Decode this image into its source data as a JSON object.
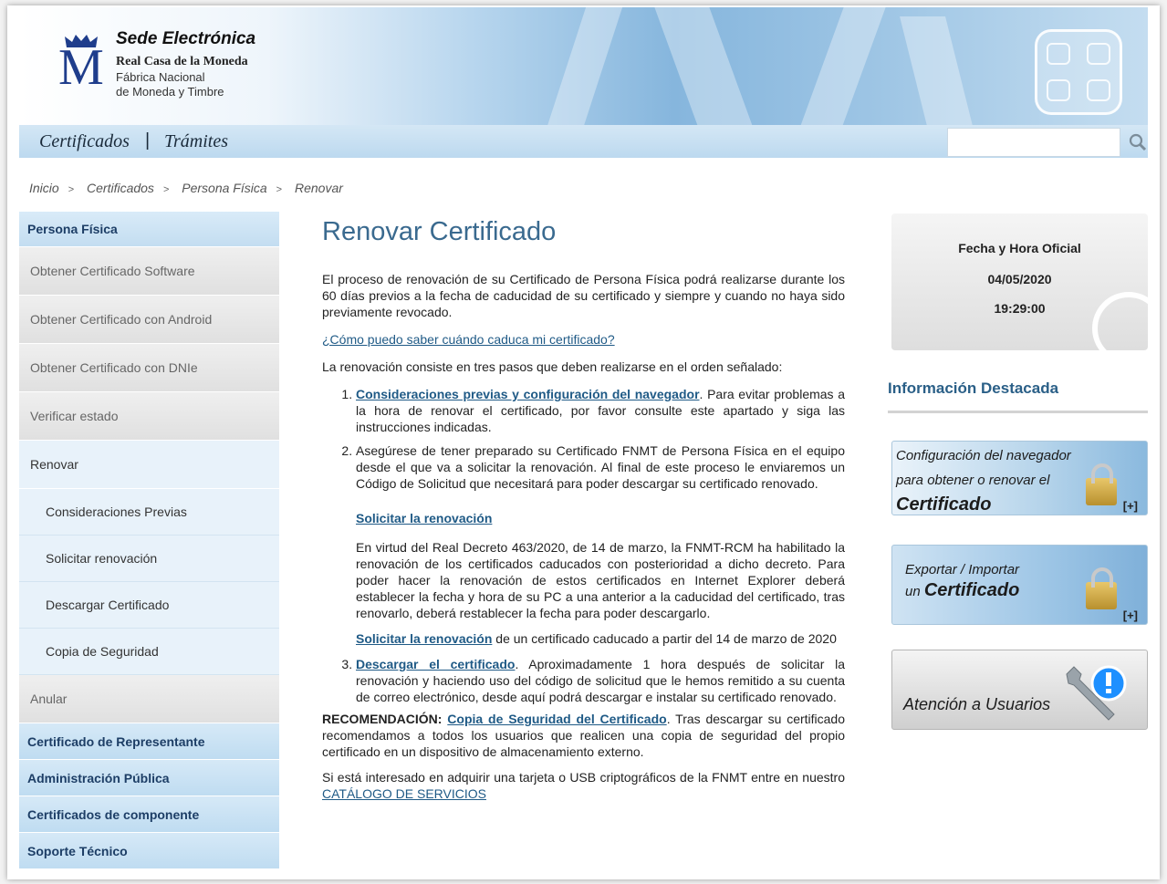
{
  "header": {
    "brand_title": "Sede Electrónica",
    "brand_line1": "Real Casa de la Moneda",
    "brand_line2": "Fábrica Nacional",
    "brand_line3": "de Moneda y Timbre",
    "logo_letter": "M"
  },
  "nav": {
    "items": [
      "Certificados",
      "Trámites"
    ],
    "separator": "|",
    "search_placeholder": ""
  },
  "breadcrumb": {
    "items": [
      "Inicio",
      "Certificados",
      "Persona Física",
      "Renovar"
    ],
    "separator": ">"
  },
  "sidebar": {
    "header": "Persona Física",
    "items": [
      "Obtener Certificado Software",
      "Obtener Certificado con Android",
      "Obtener Certificado con DNIe",
      "Verificar estado",
      "Renovar"
    ],
    "sub_items": [
      "Consideraciones Previas",
      "Solicitar renovación",
      "Descargar Certificado",
      "Copia de Seguridad"
    ],
    "after": "Anular",
    "sections": [
      "Certificado de Representante",
      "Administración Pública",
      "Certificados de componente",
      "Soporte Técnico"
    ]
  },
  "main": {
    "title": "Renovar Certificado",
    "intro": "El proceso de renovación de su Certificado de Persona Física podrá realizarse durante los 60 días previos a la fecha de caducidad de su certificado y siempre y cuando no haya sido previamente revocado.",
    "faq_link": "¿Cómo puedo saber cuándo caduca mi certificado?",
    "steps_intro": "La renovación consiste en tres pasos que deben realizarse en el orden señalado:",
    "step1_link": "Consideraciones previas y configuración del navegador",
    "step1_text": ". Para evitar problemas a la hora de renovar el certificado, por favor consulte este apartado y siga las instrucciones indicadas.",
    "step2_text": "Asegúrese de tener preparado su Certificado FNMT de Persona Física en el equipo desde el que va a solicitar la renovación. Al final de este proceso le enviaremos un Código de Solicitud que necesitará para poder descargar su certificado renovado.",
    "step2_link1": "Solicitar la renovación",
    "step2_decree": "En virtud del Real Decreto 463/2020, de 14 de marzo, la FNMT-RCM ha habilitado la renovación de los certificados caducados con posterioridad a dicho decreto. Para poder hacer la renovación de estos certificados en Internet Explorer deberá establecer la fecha y hora de su PC a una anterior a la caducidad del certificado, tras renovarlo, deberá restablecer la fecha para poder descargarlo.",
    "step2_link2": "Solicitar la renovación",
    "step2_link2_text": " de un certificado caducado a partir del 14 de marzo de 2020",
    "step3_link": "Descargar el certificado",
    "step3_text": ". Aproximadamente 1 hora después de solicitar la renovación y haciendo uso del código de solicitud que le hemos remitido a su cuenta de correo electrónico, desde aquí podrá descargar e instalar su certificado renovado.",
    "rec_label": "RECOMENDACIÓN:",
    "rec_link": "Copia de Seguridad del Certificado",
    "rec_text": ". Tras descargar su certificado recomendamos a todos los usuarios que realicen una copia de seguridad del propio certificado en un dispositivo de almacenamiento externo.",
    "catalog_text": "Si está interesado en adquirir una tarjeta o USB criptográficos de la FNMT entre en nuestro ",
    "catalog_link": "CATÁLOGO DE SERVICIOS"
  },
  "clock": {
    "label": "Fecha y Hora Oficial",
    "date": "04/05/2020",
    "time": "19:29:00"
  },
  "info": {
    "title": "Información Destacada",
    "promo1_l1": "Configuración del navegador",
    "promo1_l2": "para obtener o renovar el",
    "promo1_big": "Certificado",
    "promo1_plus": "[+]",
    "promo2_l1": "Exportar / Importar",
    "promo2_l2": "un",
    "promo2_big": "Certificado",
    "promo2_plus": "[+]",
    "promo3": "Atención a Usuarios"
  }
}
